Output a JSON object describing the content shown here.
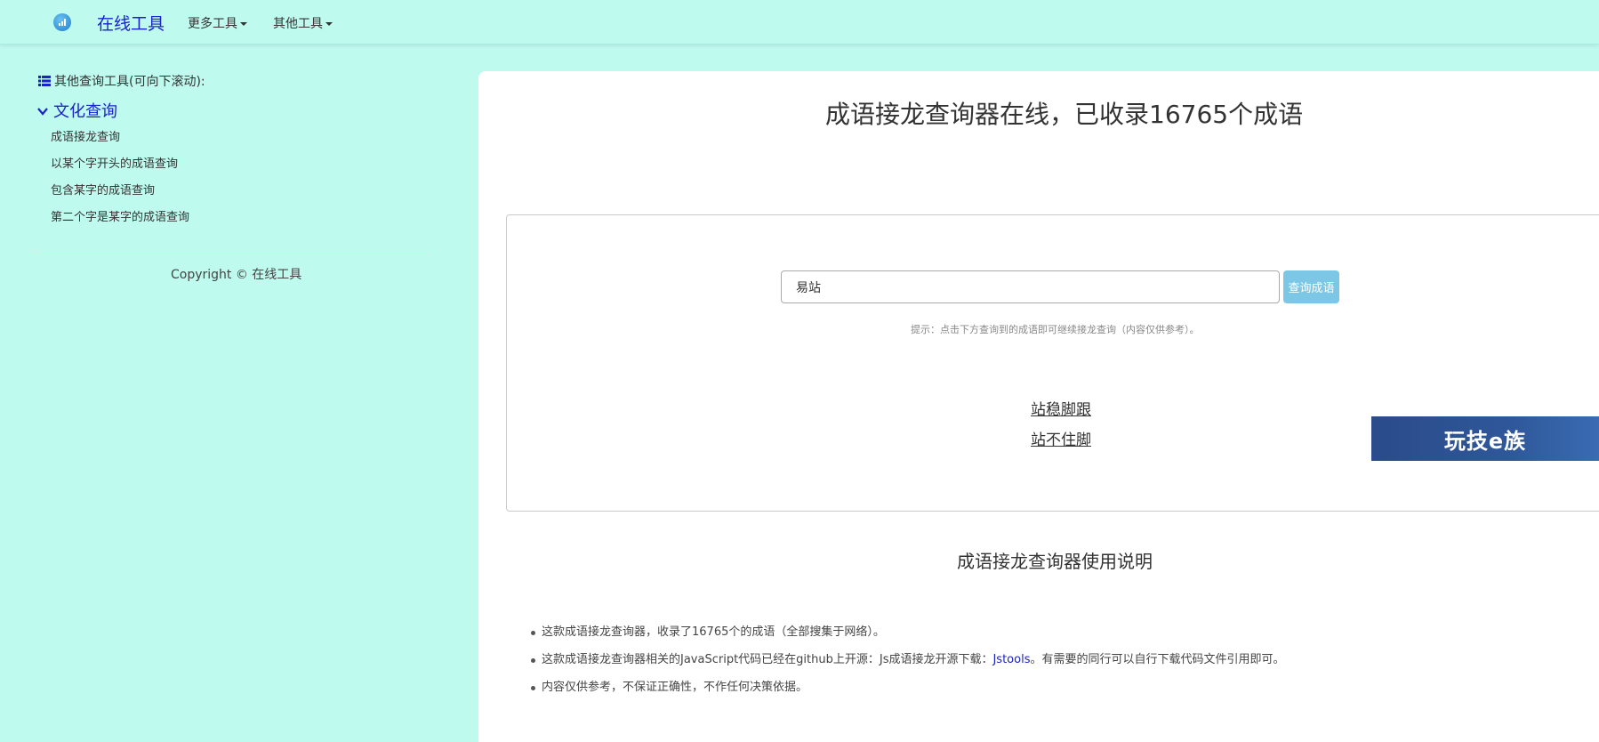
{
  "nav": {
    "brand": "在线工具",
    "menu_more": "更多工具",
    "menu_other": "其他工具"
  },
  "sidebar": {
    "section_title": "其他查询工具(可向下滚动):",
    "category": "文化查询",
    "links": [
      "成语接龙查询",
      "以某个字开头的成语查询",
      "包含某字的成语查询",
      "第二个字是某字的成语查询"
    ],
    "copyright": "Copyright © 在线工具"
  },
  "main": {
    "title": "成语接龙查询器在线，已收录16765个成语",
    "search": {
      "value": "易站",
      "button": "查询成语"
    },
    "hint": "提示：点击下方查询到的成语即可继续接龙查询（内容仅供参考）。",
    "results": [
      "站稳脚跟",
      "站不住脚"
    ],
    "ad_text": "玩技e族",
    "usage_title": "成语接龙查询器使用说明",
    "notes": {
      "n1": "这款成语接龙查询器，收录了16765个的成语（全部搜集于网络）。",
      "n2_prefix": "这款成语接龙查询器相关的JavaScript代码已经在github上开源：Js成语接龙开源下载：",
      "n2_link": "Jstools",
      "n2_suffix": "。有需要的同行可以自行下载代码文件引用即可。",
      "n3": "内容仅供参考，不保证正确性，不作任何决策依据。"
    }
  },
  "colors": {
    "background": "#bffaef",
    "brand": "#1a23c9",
    "button": "#7dc7e6",
    "ad": "#2e5799"
  },
  "icons": [
    "logo-icon",
    "list-icon",
    "chevron-down-icon",
    "caret-down-icon"
  ]
}
